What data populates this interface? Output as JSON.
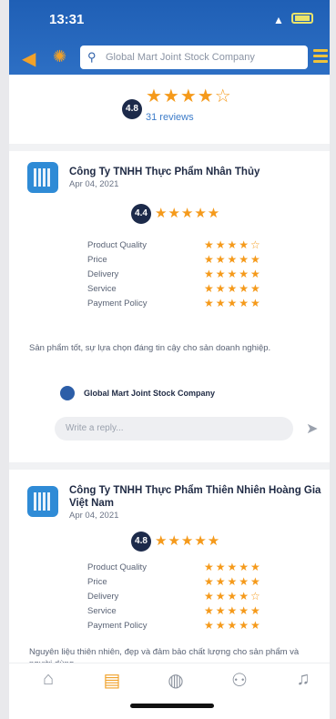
{
  "status": {
    "time": "13:31"
  },
  "header": {
    "search_text": "Global Mart Joint Stock Company"
  },
  "summary": {
    "rating": "4.8",
    "stars": "★★★★☆",
    "reviews": "31 reviews"
  },
  "reviews": [
    {
      "company": "Công Ty TNHH Thực Phẩm Nhân Thủy",
      "date": "Apr 04, 2021",
      "rating": "4.4",
      "stars": "★★★★★",
      "criteria": [
        {
          "label": "Product Quality",
          "stars": "★★★★☆"
        },
        {
          "label": "Price",
          "stars": "★★★★★"
        },
        {
          "label": "Delivery",
          "stars": "★★★★★"
        },
        {
          "label": "Service",
          "stars": "★★★★★"
        },
        {
          "label": "Payment Policy",
          "stars": "★★★★★"
        }
      ],
      "text": "Sản phẩm tốt, sự lựa chọn đáng tin cậy cho sản doanh nghiệp.",
      "reply_name": "Global Mart Joint Stock Company",
      "reply_placeholder": "Write a reply..."
    },
    {
      "company": "Công Ty TNHH Thực Phẩm Thiên Nhiên Hoàng Gia Việt Nam",
      "date": "Apr 04, 2021",
      "rating": "4.8",
      "stars": "★★★★★",
      "criteria": [
        {
          "label": "Product Quality",
          "stars": "★★★★★"
        },
        {
          "label": "Price",
          "stars": "★★★★★"
        },
        {
          "label": "Delivery",
          "stars": "★★★★☆"
        },
        {
          "label": "Service",
          "stars": "★★★★★"
        },
        {
          "label": "Payment Policy",
          "stars": "★★★★★"
        }
      ],
      "text": "Nguyên liệu thiên nhiên, đẹp và đảm bảo chất lượng cho sản phẩm và người dùng."
    }
  ],
  "tabs": [
    {
      "icon": "home-icon",
      "glyph": "⌂"
    },
    {
      "icon": "document-icon",
      "glyph": "▤"
    },
    {
      "icon": "globe-icon",
      "glyph": "◍"
    },
    {
      "icon": "people-icon",
      "glyph": "⚇"
    },
    {
      "icon": "bell-icon",
      "glyph": "♫"
    }
  ],
  "colors": {
    "header": "#2d6fc4",
    "accent": "#f59a1b",
    "badge": "#1c2a4a",
    "link": "#3d7cc9"
  }
}
